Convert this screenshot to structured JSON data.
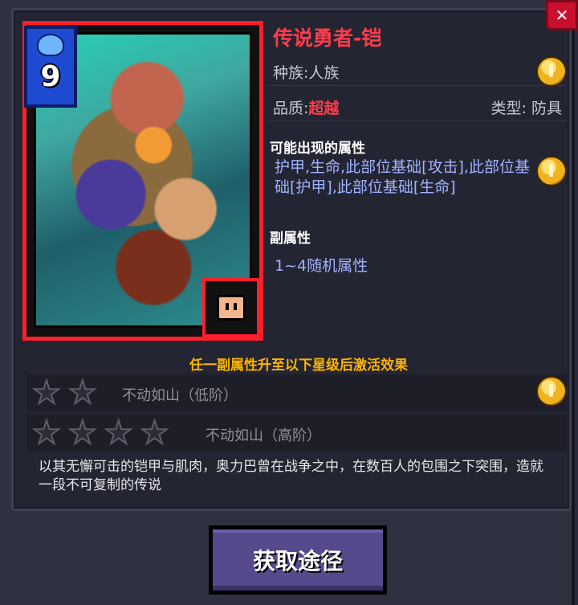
{
  "card": {
    "name": "传说勇者-铠",
    "cost": "9",
    "race": "种族:人族",
    "quality_label": "品质:",
    "quality_value": "超越",
    "type": "类型:  防具"
  },
  "possible_attrs": {
    "title": "可能出现的属性",
    "text": "护甲,生命,此部位基础[攻击],此部位基础[护甲],此部位基础[生命]"
  },
  "sub_attrs": {
    "title": "副属性",
    "text": "1~4随机属性"
  },
  "activation": {
    "title": "任一副属性升至以下星级后激活效果",
    "tiers": [
      {
        "stars": 2,
        "effect": "不动如山（低阶）"
      },
      {
        "stars": 4,
        "effect": "不动如山（高阶）"
      }
    ]
  },
  "description": "以其无懈可击的铠甲与肌肉，奥力巴曾在战争之中，在数百人的包围之下突围，造就一段不可复制的传说",
  "buttons": {
    "obtain": "获取途径"
  },
  "colors": {
    "name": "#ff3c4a",
    "attr_text": "#9fb2ff",
    "activation_title": "#ffb400",
    "card_border": "#ff1f2c"
  },
  "icons": {
    "coin": "gold-coin-icon",
    "cost": "mana-cost-icon",
    "slot": "armor-slot-icon",
    "close": "close-icon"
  }
}
